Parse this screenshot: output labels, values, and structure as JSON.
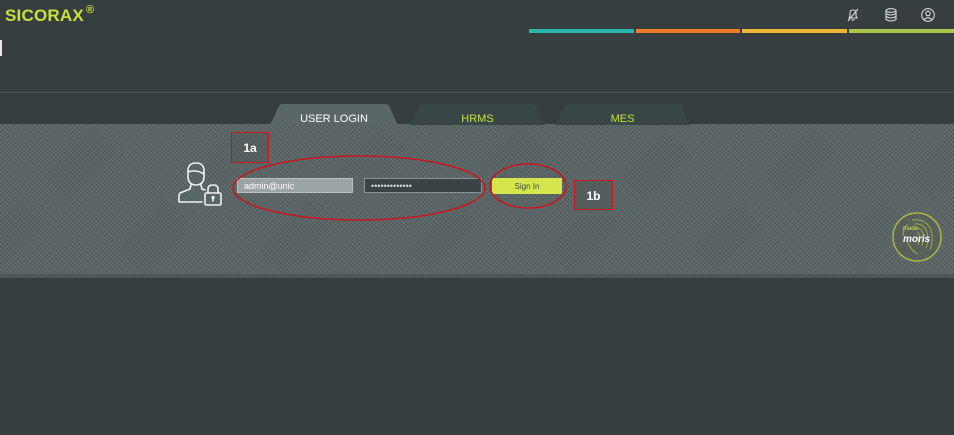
{
  "app": {
    "brand": "SICORAX",
    "brand_mark": "®"
  },
  "header": {
    "icons": [
      "bell-off-icon",
      "database-icon",
      "user-circle-icon"
    ],
    "color_strip": [
      "#2bb5ad",
      "#ef7a2a",
      "#f2b636",
      "#a9c84a"
    ]
  },
  "tabs": [
    {
      "label": "USER LOGIN",
      "active": true
    },
    {
      "label": "HRMS",
      "active": false
    },
    {
      "label": "MES",
      "active": false
    }
  ],
  "login": {
    "username_value": "admin@unic",
    "password_value": "•••••••••••••",
    "signin_label": "Sign In"
  },
  "annotations": {
    "label_1a": "1a",
    "label_1b": "1b"
  },
  "badge": {
    "line1": "made",
    "line2": "moris"
  },
  "colors": {
    "accent": "#c8e03a",
    "background": "#373e3f",
    "panel": "#5b6667",
    "annotation": "#c8161c"
  }
}
